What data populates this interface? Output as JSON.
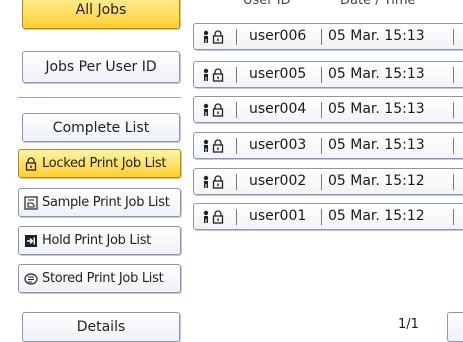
{
  "header": {
    "user_id_label": "User ID",
    "date_time_label": "Date / Time"
  },
  "sidebar": {
    "all_jobs": "All Jobs",
    "jobs_per_user": "Jobs Per User ID",
    "complete_list": "Complete List",
    "locked_list": "Locked Print Job List",
    "sample_list": "Sample Print Job List",
    "hold_list": "Hold Print Job List",
    "stored_list": "Stored Print Job List",
    "details": "Details"
  },
  "jobs": [
    {
      "user": "user006",
      "datetime": "05 Mar. 15:13"
    },
    {
      "user": "user005",
      "datetime": "05 Mar. 15:13"
    },
    {
      "user": "user004",
      "datetime": "05 Mar. 15:13"
    },
    {
      "user": "user003",
      "datetime": "05 Mar. 15:13"
    },
    {
      "user": "user002",
      "datetime": "05 Mar. 15:12"
    },
    {
      "user": "user001",
      "datetime": "05 Mar. 15:12"
    }
  ],
  "pager": {
    "page": "1/1"
  },
  "colors": {
    "selected": "#ffcf2e",
    "button_border": "#8a97ad"
  }
}
